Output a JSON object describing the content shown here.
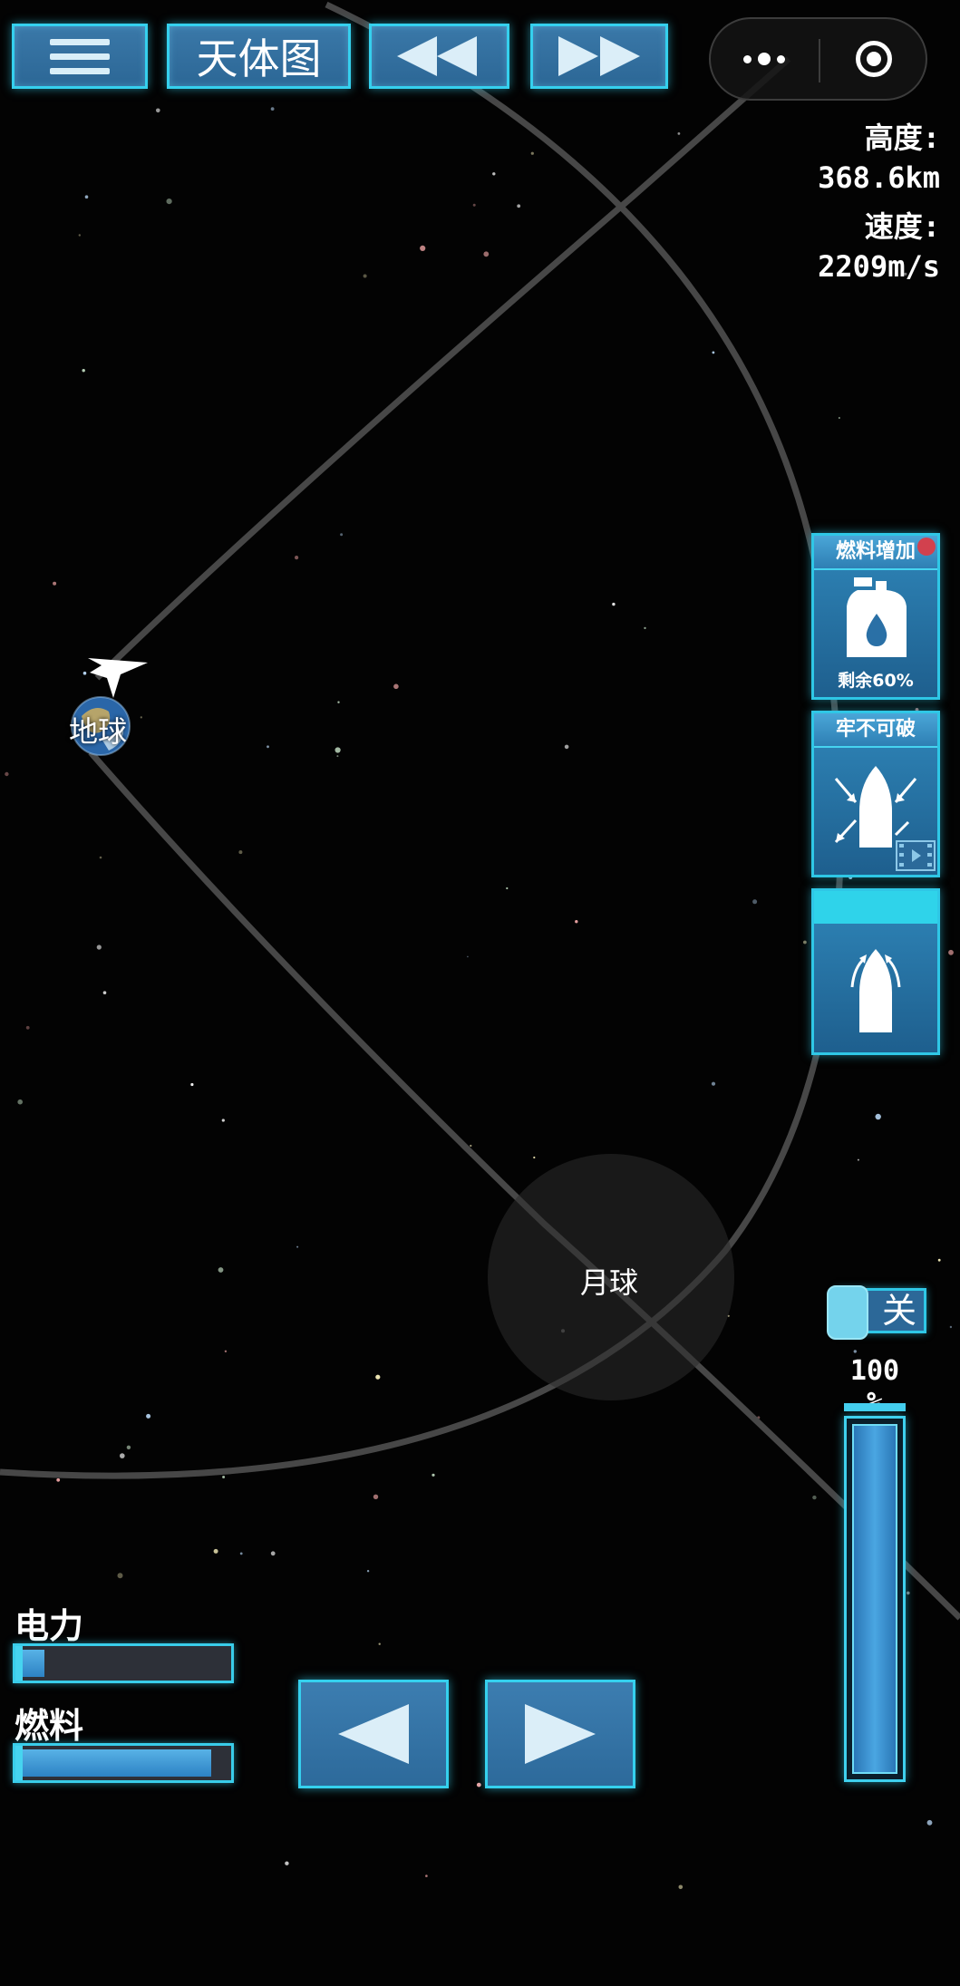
{
  "top_bar": {
    "menu_icon": "hamburger-icon",
    "map_button_label": "天体图",
    "rewind_icon": "double-left-triangle-icon",
    "fast_forward_icon": "double-right-triangle-icon",
    "mini_program_more_icon": "more-dots-icon",
    "mini_program_close_icon": "target-circle-icon"
  },
  "telemetry": {
    "altitude_label": "高度:",
    "altitude_value": "368.6km",
    "speed_label": "速度:",
    "speed_value": "2209m/s"
  },
  "power_ups": {
    "fuel": {
      "title": "燃料增加",
      "footer": "剩余60%",
      "icon": "fuel-canister-icon",
      "has_notification": true
    },
    "shield": {
      "title": "牢不可破",
      "icon": "rocket-shield-icon",
      "badge_icon": "video-ad-icon"
    },
    "boost": {
      "icon": "rocket-boost-icon"
    }
  },
  "celestial": {
    "earth_label": "地球",
    "moon_label": "月球"
  },
  "auto_toggle": {
    "label": "关",
    "state": "off"
  },
  "throttle": {
    "percent_label": "100 %",
    "level": 1.0
  },
  "meters": {
    "power_label": "电力",
    "power_level": 0.12,
    "fuel_label": "燃料",
    "fuel_level": 0.92
  },
  "controls": {
    "left_icon": "left-triangle-icon",
    "right_icon": "right-triangle-icon"
  },
  "colors": {
    "accent_cyan": "#35d0ee",
    "button_blue": "#2d6a9b",
    "orbit_gray": "#4a4a4a",
    "background": "#030303"
  }
}
